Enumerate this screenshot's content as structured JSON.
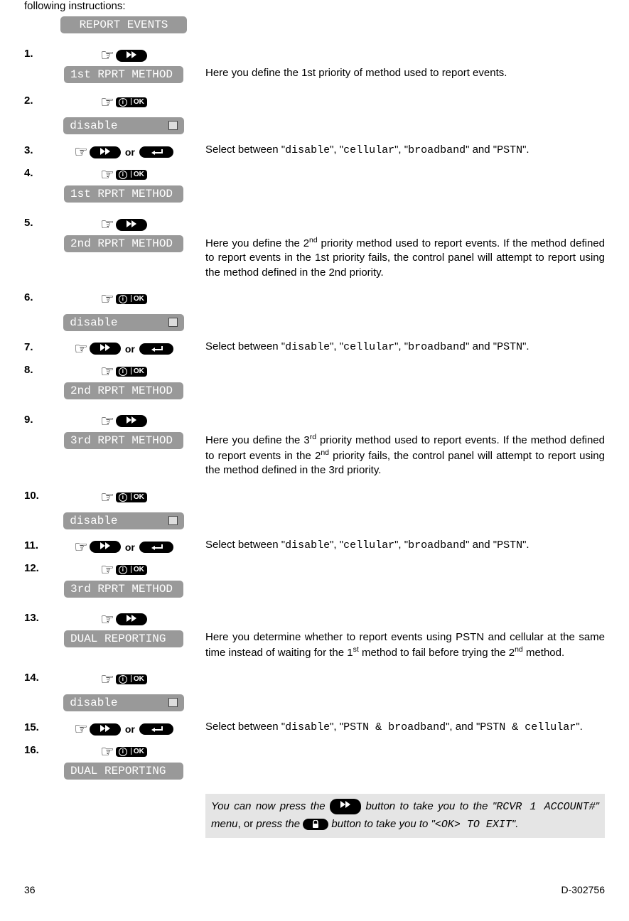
{
  "intro": "following instructions:",
  "headerBox": "REPORT EVENTS",
  "steps": [
    {
      "num": "1.",
      "type": "ff_then_box",
      "box": "1st RPRT METHOD",
      "desc": "Here you define the 1st priority of method used to report events."
    },
    {
      "num": "2.",
      "type": "ok_then_disable",
      "box": "disable"
    },
    {
      "num": "3.",
      "type": "ff_or_ret",
      "desc_parts": {
        "pre": "Select between \"",
        "o1": "disable",
        "m1": "\", \"",
        "o2": "cellular",
        "m2": "\", \"",
        "o3": "broadband",
        "m3": "\" and \"",
        "o4": "PSTN",
        "post": "\"."
      }
    },
    {
      "num": "4.",
      "type": "ok_then_box",
      "box": "1st RPRT METHOD"
    },
    {
      "num": "5.",
      "type": "ff_then_box",
      "box": "2nd RPRT METHOD",
      "desc_html": "Here you define the 2<sup>nd</sup> priority method used to report events. If the method defined to report events in the 1st priority fails, the control panel will attempt to report using the method defined in the 2nd priority."
    },
    {
      "num": "6.",
      "type": "ok_then_disable",
      "box": "disable"
    },
    {
      "num": "7.",
      "type": "ff_or_ret",
      "desc_parts": {
        "pre": "Select between \"",
        "o1": "disable",
        "m1": "\", \"",
        "o2": "cellular",
        "m2": "\", \"",
        "o3": "broadband",
        "m3": "\" and \"",
        "o4": "PSTN",
        "post": "\"."
      }
    },
    {
      "num": "8.",
      "type": "ok_then_box",
      "box": "2nd RPRT METHOD"
    },
    {
      "num": "9.",
      "type": "ff_then_box",
      "box": "3rd RPRT METHOD",
      "desc_html": "Here you define the 3<sup>rd</sup> priority method used to report events. If the method defined to report events in the 2<sup>nd</sup> priority fails, the control panel will attempt to report using the method defined in the 3rd priority."
    },
    {
      "num": "10.",
      "type": "ok_then_disable",
      "box": "disable"
    },
    {
      "num": "11.",
      "type": "ff_or_ret",
      "desc_parts": {
        "pre": "Select between \"",
        "o1": "disable",
        "m1": "\", \"",
        "o2": "cellular",
        "m2": "\", \"",
        "o3": "broadband",
        "m3": "\" and \"",
        "o4": "PSTN",
        "post": "\"."
      }
    },
    {
      "num": "12.",
      "type": "ok_then_box",
      "box": "3rd RPRT METHOD"
    },
    {
      "num": "13.",
      "type": "ff_then_box",
      "box": "DUAL REPORTING",
      "desc_html": "Here you determine whether to report events using PSTN and cellular at the same time instead of waiting for the 1<sup>st</sup> method to fail before trying the 2<sup>nd</sup> method."
    },
    {
      "num": "14.",
      "type": "ok_then_disable",
      "box": "disable"
    },
    {
      "num": "15.",
      "type": "ff_or_ret",
      "desc_parts2": {
        "pre": "Select between \"",
        "o1": "disable",
        "m1": "\", \"",
        "o2": "PSTN & broadband",
        "m2": "\", and \"",
        "o3": "PSTN & cellular",
        "post": "\"."
      }
    },
    {
      "num": "16.",
      "type": "ok_then_box",
      "box": "DUAL REPORTING"
    }
  ],
  "or_label": "or",
  "ok_label": "OK",
  "note": {
    "p1": "You can now press the ",
    "p2": " button to take you to the \"",
    "menu1": "RCVR 1 ACCOUNT#",
    "p3": "\" menu",
    "p4": ", or ",
    "p5": "press the ",
    "p6": " button to take you to \"",
    "menu2": "<OK> TO EXIT",
    "p7": "\"."
  },
  "footer": {
    "page": "36",
    "doc": "D-302756"
  }
}
